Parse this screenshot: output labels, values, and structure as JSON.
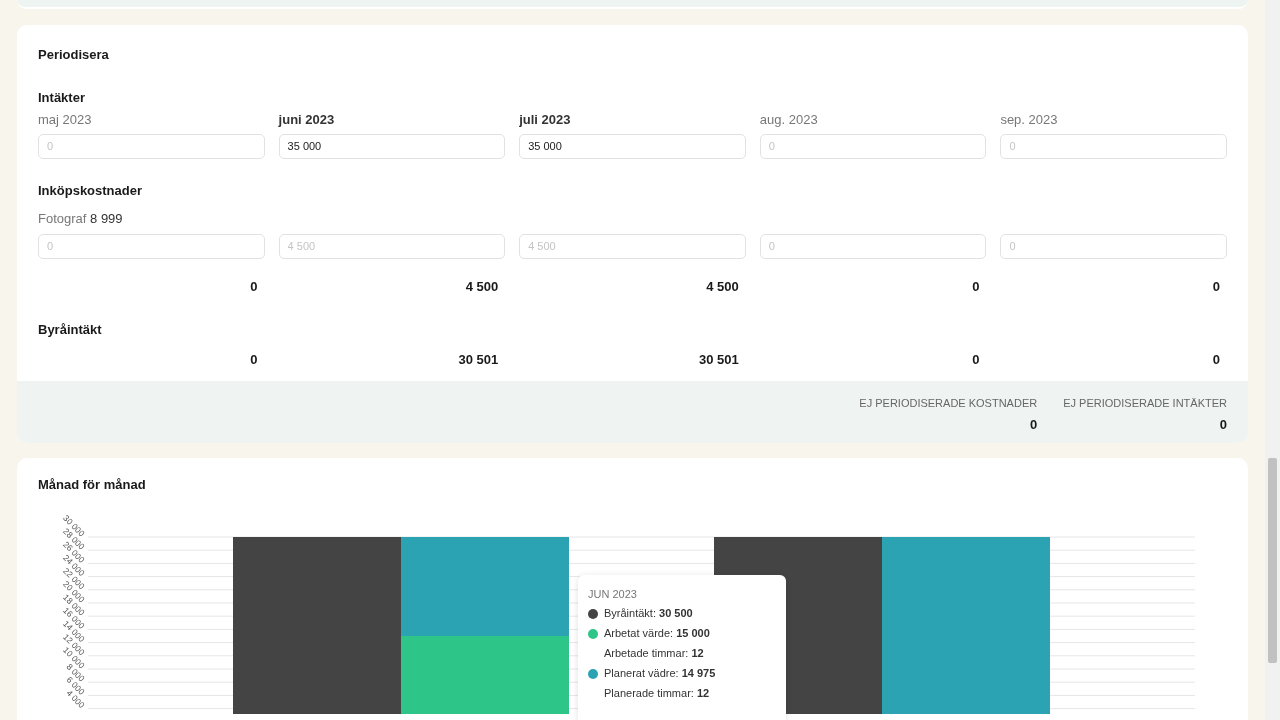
{
  "periodize": {
    "title": "Periodisera",
    "revenue": {
      "title": "Intäkter",
      "months": [
        {
          "label": "maj 2023",
          "active": false,
          "placeholder": "0"
        },
        {
          "label": "juni 2023",
          "active": true,
          "value": "35 000"
        },
        {
          "label": "juli 2023",
          "active": true,
          "value": "35 000"
        },
        {
          "label": "aug. 2023",
          "active": false,
          "placeholder": "0"
        },
        {
          "label": "sep. 2023",
          "active": false,
          "placeholder": "0"
        }
      ]
    },
    "costs": {
      "title": "Inköpskostnader",
      "item": {
        "name": "Fotograf",
        "amount": "8 999"
      },
      "placeholders": [
        "0",
        "4 500",
        "4 500",
        "0",
        "0"
      ],
      "totals": [
        "0",
        "4 500",
        "4 500",
        "0",
        "0"
      ]
    },
    "agency_income": {
      "title": "Byråintäkt",
      "values": [
        "0",
        "30 501",
        "30 501",
        "0",
        "0"
      ]
    },
    "summary": [
      {
        "label": "EJ PERIODISERADE KOSTNADER",
        "value": "0"
      },
      {
        "label": "EJ PERIODISERADE INTÄKTER",
        "value": "0"
      }
    ]
  },
  "monthly": {
    "title": "Månad för månad",
    "chart_data": {
      "type": "bar",
      "grid": true,
      "stacked": true,
      "ylim": [
        0,
        30000
      ],
      "yticks": [
        {
          "value": 4000,
          "label": "4 000"
        },
        {
          "value": 6000,
          "label": "6 000"
        },
        {
          "value": 8000,
          "label": "8 000"
        },
        {
          "value": 10000,
          "label": "10 000"
        },
        {
          "value": 12000,
          "label": "12 000"
        },
        {
          "value": 14000,
          "label": "14 000"
        },
        {
          "value": 16000,
          "label": "16 000"
        },
        {
          "value": 18000,
          "label": "18 000"
        },
        {
          "value": 20000,
          "label": "20 000"
        },
        {
          "value": 22000,
          "label": "22 000"
        },
        {
          "value": 24000,
          "label": "24 000"
        },
        {
          "value": 26000,
          "label": "26 000"
        },
        {
          "value": 28000,
          "label": "28 000"
        },
        {
          "value": 30000,
          "label": "30 000"
        }
      ],
      "series": [
        {
          "color": "#444444",
          "values": [
            30000,
            null,
            30000,
            null
          ]
        },
        {
          "color": "#2ec589",
          "values": [
            null,
            15000,
            null,
            0
          ]
        },
        {
          "color": "#2ca3b3",
          "values": [
            null,
            15000,
            null,
            30000
          ]
        }
      ]
    },
    "tooltip": {
      "title": "JUN 2023",
      "rows": [
        {
          "label": "Byråintäkt:",
          "value": "30 500",
          "color": "#444444"
        },
        {
          "label": "Arbetat värde:",
          "value": "15 000",
          "color": "#2ec589"
        },
        {
          "label": "Arbetade timmar:",
          "value": "12"
        },
        {
          "label": "Planerat vädre:",
          "value": "14 975",
          "color": "#2ca3b3"
        },
        {
          "label": "Planerade timmar:",
          "value": "12"
        }
      ]
    }
  }
}
